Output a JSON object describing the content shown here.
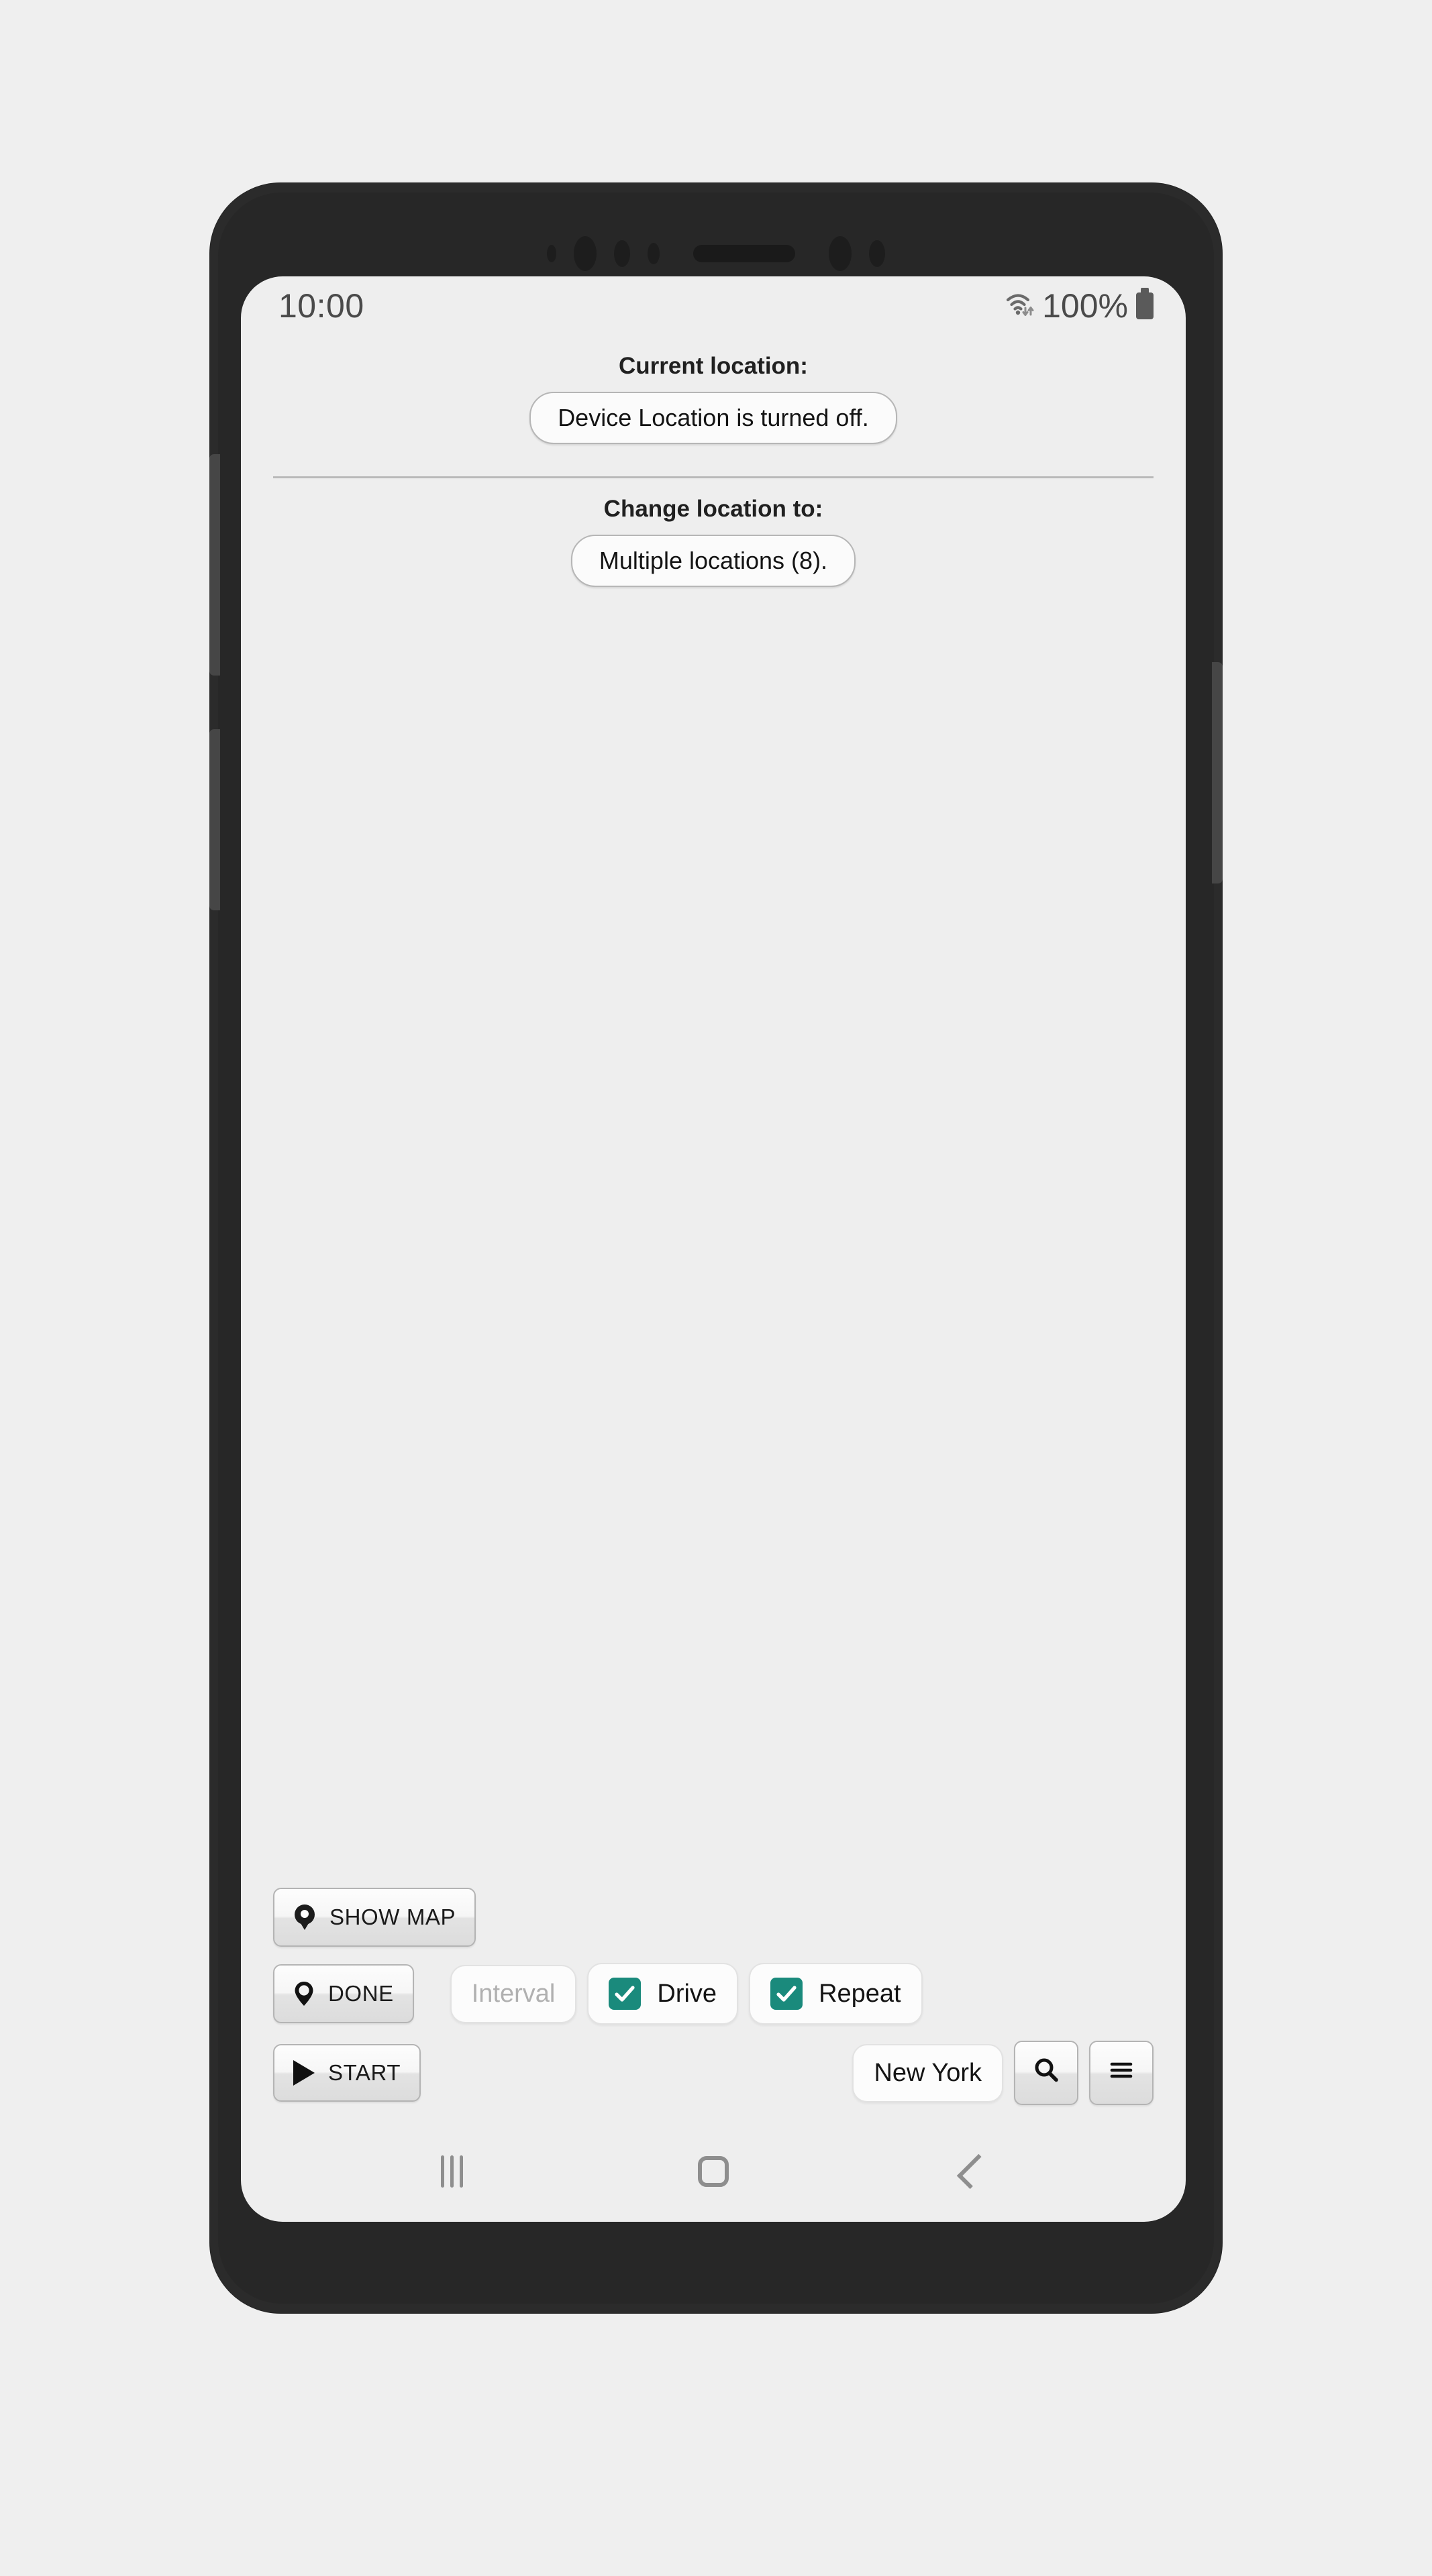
{
  "background_color": "#efefef",
  "accent_color": "#1a8a7c",
  "phone": {
    "frame_color": "#2b2b2b",
    "screen_background": "#eeeeee"
  },
  "status_bar": {
    "time": "10:00",
    "wifi_icon": "wifi-with-transfer-arrows-icon",
    "battery_percent": "100%",
    "battery_icon": "battery-full-icon"
  },
  "app": {
    "current_location": {
      "heading": "Current location:",
      "value": "Device Location is turned off."
    },
    "change_location": {
      "heading": "Change location to:",
      "value": "Multiple locations (8)."
    },
    "controls": {
      "show_map": {
        "label": "SHOW MAP",
        "icon": "map-pin-filled-icon"
      },
      "done": {
        "label": "DONE",
        "icon": "map-pin-outline-icon"
      },
      "start": {
        "label": "START",
        "icon": "play-triangle-icon"
      },
      "interval": {
        "placeholder": "Interval",
        "value": ""
      },
      "drive": {
        "label": "Drive",
        "checked": true,
        "icon": "checkbox-checked-icon"
      },
      "repeat": {
        "label": "Repeat",
        "checked": true,
        "icon": "checkbox-checked-icon"
      },
      "search_field": {
        "value": "New York",
        "placeholder": "Search location"
      },
      "search_button": {
        "icon": "magnifier-icon"
      },
      "menu_button": {
        "icon": "hamburger-menu-icon"
      }
    }
  },
  "nav_bar": {
    "recents": "recents-icon",
    "home": "home-icon",
    "back": "back-icon"
  }
}
